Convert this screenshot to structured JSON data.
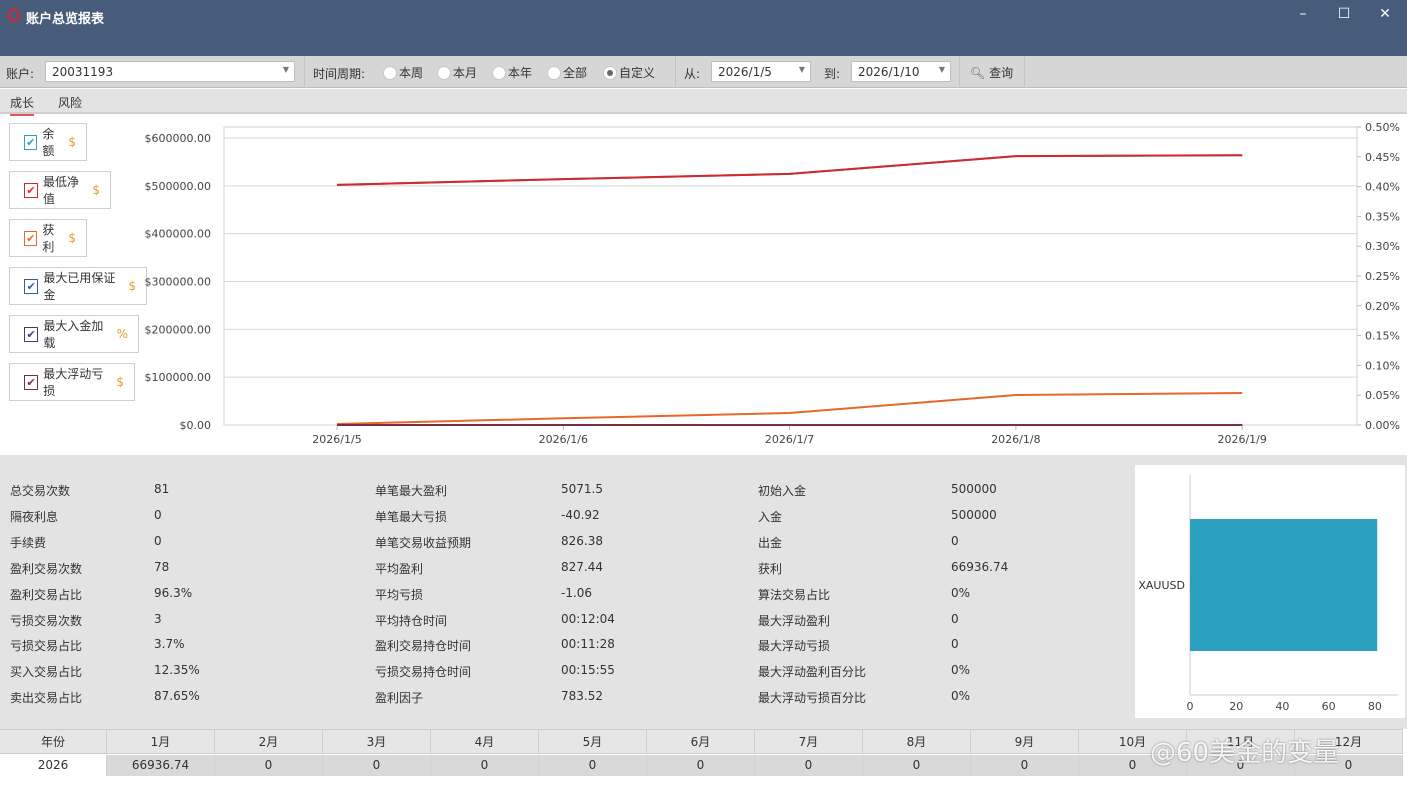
{
  "window": {
    "title": "账户总览报表",
    "minimize": "–",
    "maximize": "☐",
    "close": "✕"
  },
  "toolbar": {
    "account_label": "账户:",
    "account_value": "20031193",
    "period_label": "时间周期:",
    "periods": [
      {
        "label": "本周",
        "selected": false
      },
      {
        "label": "本月",
        "selected": false
      },
      {
        "label": "本年",
        "selected": false
      },
      {
        "label": "全部",
        "selected": false
      },
      {
        "label": "自定义",
        "selected": true
      }
    ],
    "from_label": "从:",
    "from_value": "2026/1/5",
    "to_label": "到:",
    "to_value": "2026/1/10",
    "query_label": "查询"
  },
  "tabs": [
    {
      "label": "成长",
      "active": true
    },
    {
      "label": "风险",
      "active": false
    }
  ],
  "legend": [
    {
      "label": "余额",
      "unit": "$",
      "color": "#2ea0c0",
      "checked": true
    },
    {
      "label": "最低净值",
      "unit": "$",
      "color": "#d8262b",
      "checked": true
    },
    {
      "label": "获利",
      "unit": "$",
      "color": "#e8672a",
      "checked": true
    },
    {
      "label": "最大已用保证金",
      "unit": "$",
      "color": "#3a5a9a",
      "checked": true
    },
    {
      "label": "最大入金加载",
      "unit": "%",
      "color": "#3d3f6e",
      "checked": true
    },
    {
      "label": "最大浮动亏损",
      "unit": "$",
      "color": "#7a3040",
      "checked": true
    }
  ],
  "chart_data": [
    {
      "type": "line",
      "x": [
        "2026/1/5",
        "2026/1/6",
        "2026/1/7",
        "2026/1/8",
        "2026/1/9"
      ],
      "ylim": [
        0,
        600000
      ],
      "y_ticks": [
        "$0.00",
        "$100000.00",
        "$200000.00",
        "$300000.00",
        "$400000.00",
        "$500000.00",
        "$600000.00"
      ],
      "y2lim": [
        0,
        0.5
      ],
      "y2_ticks": [
        "0.00%",
        "0.05%",
        "0.10%",
        "0.15%",
        "0.20%",
        "0.25%",
        "0.30%",
        "0.35%",
        "0.40%",
        "0.45%",
        "0.50%"
      ],
      "series": [
        {
          "name": "余额",
          "color": "#2ea0c0",
          "values": [
            502000,
            514000,
            525000,
            562000,
            564000
          ]
        },
        {
          "name": "最低净值",
          "color": "#d8262b",
          "values": [
            502000,
            514000,
            525000,
            562000,
            564000
          ]
        },
        {
          "name": "获利",
          "color": "#e8672a",
          "values": [
            2000,
            14000,
            25000,
            62700,
            66936.74
          ]
        },
        {
          "name": "最大已用保证金",
          "color": "#3a5a9a",
          "values": [
            0,
            0,
            0,
            0,
            0
          ]
        },
        {
          "name": "最大浮动亏损",
          "color": "#7a3040",
          "values": [
            0,
            0,
            0,
            0,
            0
          ]
        }
      ]
    },
    {
      "type": "bar",
      "orientation": "horizontal",
      "categories": [
        "XAUUSD"
      ],
      "values": [
        81
      ],
      "color": "#2ca1bf",
      "xlim": [
        0,
        90
      ],
      "x_ticks": [
        "0",
        "20",
        "40",
        "60",
        "80"
      ]
    }
  ],
  "stats": [
    [
      [
        "总交易次数",
        "81"
      ],
      [
        "隔夜利息",
        "0"
      ],
      [
        "手续费",
        "0"
      ],
      [
        "盈利交易次数",
        "78"
      ],
      [
        "盈利交易占比",
        "96.3%"
      ],
      [
        "亏损交易次数",
        "3"
      ],
      [
        "亏损交易占比",
        "3.7%"
      ],
      [
        "买入交易占比",
        "12.35%"
      ],
      [
        "卖出交易占比",
        "87.65%"
      ]
    ],
    [
      [
        "单笔最大盈利",
        "5071.5"
      ],
      [
        "单笔最大亏损",
        "-40.92"
      ],
      [
        "单笔交易收益预期",
        "826.38"
      ],
      [
        "平均盈利",
        "827.44"
      ],
      [
        "平均亏损",
        "-1.06"
      ],
      [
        "平均持仓时间",
        "00:12:04"
      ],
      [
        "盈利交易持仓时间",
        "00:11:28"
      ],
      [
        "亏损交易持仓时间",
        "00:15:55"
      ],
      [
        "盈利因子",
        "783.52"
      ]
    ],
    [
      [
        "初始入金",
        "500000"
      ],
      [
        "入金",
        "500000"
      ],
      [
        "出金",
        "0"
      ],
      [
        "获利",
        "66936.74"
      ],
      [
        "算法交易占比",
        "0%"
      ],
      [
        "最大浮动盈利",
        "0"
      ],
      [
        "最大浮动亏损",
        "0"
      ],
      [
        "最大浮动盈利百分比",
        "0%"
      ],
      [
        "最大浮动亏损百分比",
        "0%"
      ]
    ]
  ],
  "months": {
    "year_header": "年份",
    "headers": [
      "1月",
      "2月",
      "3月",
      "4月",
      "5月",
      "6月",
      "7月",
      "8月",
      "9月",
      "10月",
      "11月",
      "12月"
    ],
    "year": "2026",
    "values": [
      "66936.74",
      "0",
      "0",
      "0",
      "0",
      "0",
      "0",
      "0",
      "0",
      "0",
      "0",
      "0"
    ]
  },
  "watermark": "@60美金的变量"
}
